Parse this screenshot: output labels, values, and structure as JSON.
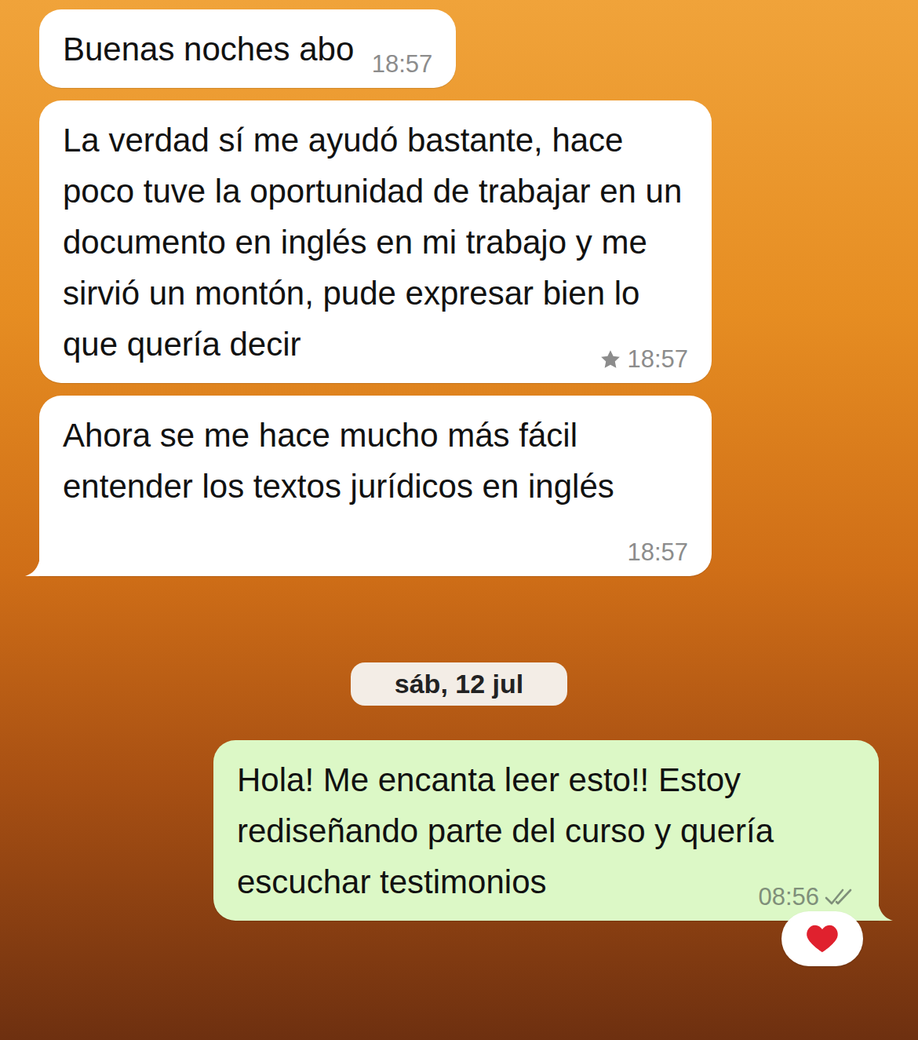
{
  "chat": {
    "items": [
      {
        "kind": "message",
        "direction": "incoming",
        "text": "Buenas noches abo",
        "time": "18:57",
        "starred": false,
        "tail": false
      },
      {
        "kind": "message",
        "direction": "incoming",
        "text": "La verdad sí me ayudó bastante, hace poco tuve la oportunidad de trabajar en un documento en inglés en mi trabajo y me sirvió un montón, pude expresar bien lo que quería decir",
        "time": "18:57",
        "starred": true,
        "tail": false
      },
      {
        "kind": "message",
        "direction": "incoming",
        "text": "Ahora se me hace mucho más fácil entender los textos jurídicos en inglés",
        "time": "18:57",
        "starred": false,
        "tail": true
      },
      {
        "kind": "date",
        "text": "sáb, 12 jul"
      },
      {
        "kind": "message",
        "direction": "outgoing",
        "text": "Hola! Me encanta leer esto!! Estoy rediseñando parte del curso y quería escuchar testimonios",
        "time": "08:56",
        "starred": false,
        "tail": true,
        "read": false,
        "reaction": true
      }
    ]
  }
}
